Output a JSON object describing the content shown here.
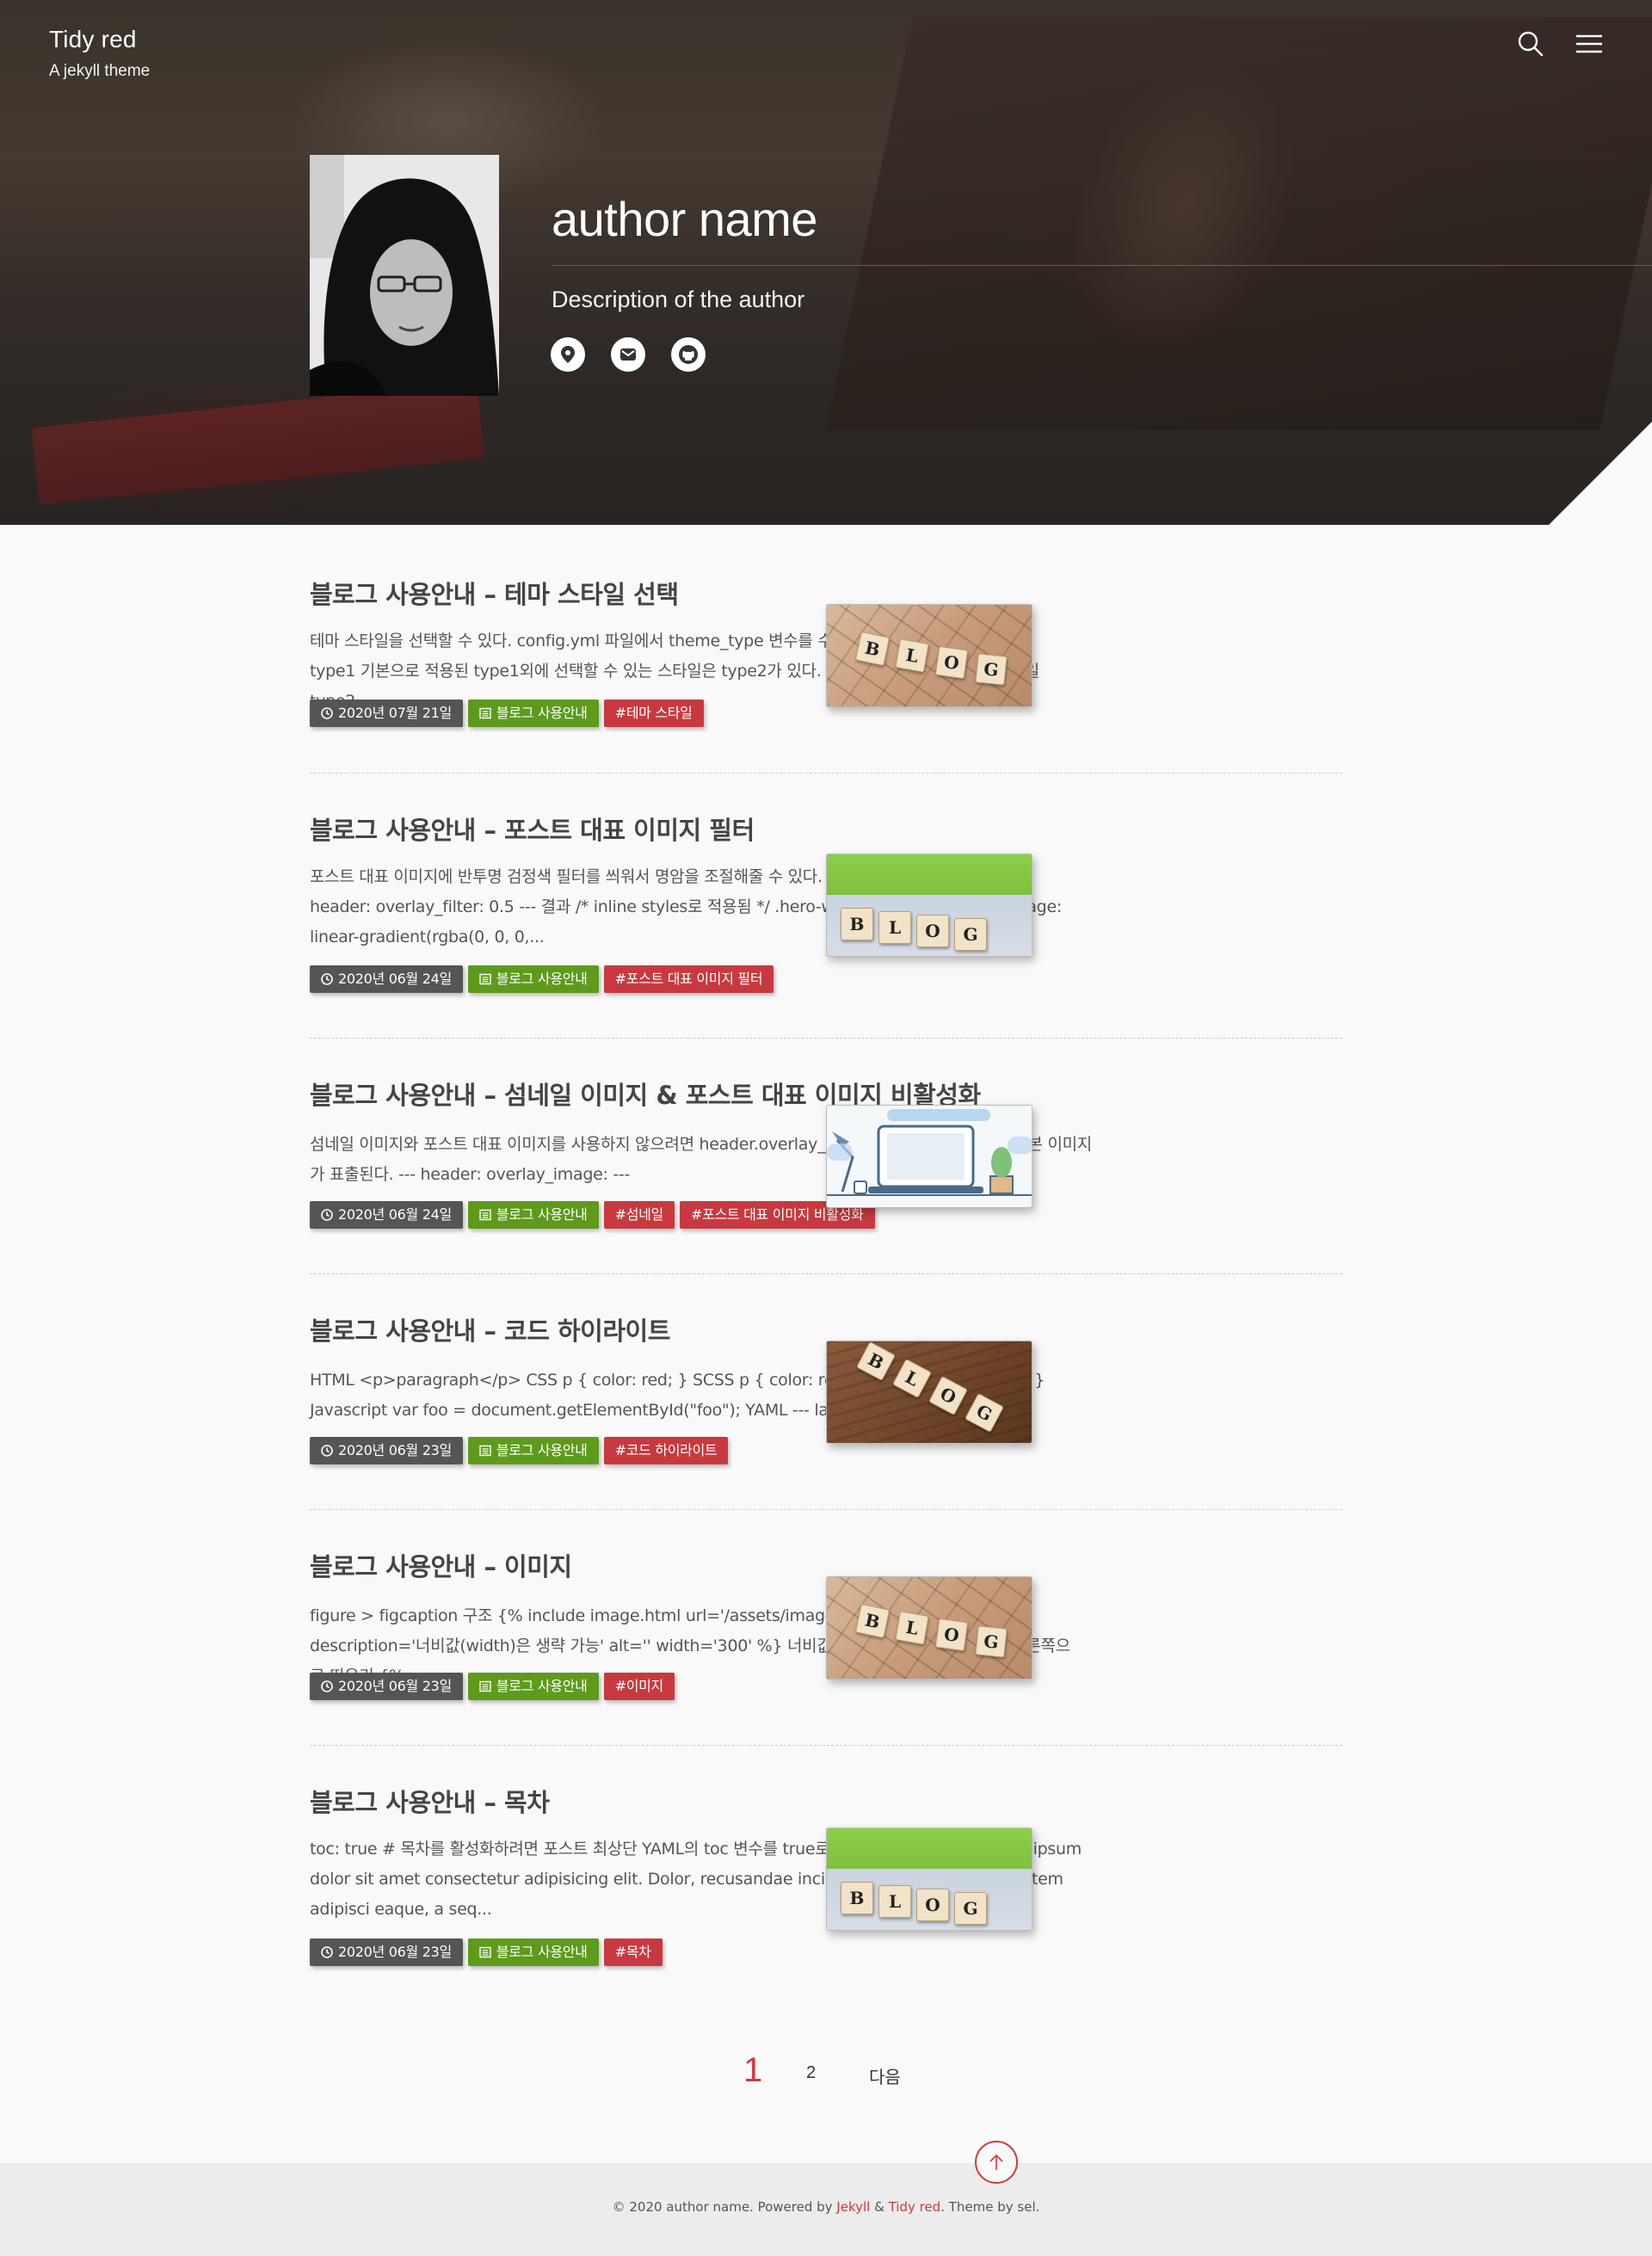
{
  "site": {
    "title": "Tidy red",
    "subtitle": "A jekyll theme"
  },
  "header": {
    "search_icon": "search-icon",
    "menu_icon": "hamburger-menu-icon"
  },
  "author": {
    "name": "author name",
    "description": "Description of the author",
    "social_icons": [
      "location-pin-icon",
      "envelope-icon",
      "github-icon"
    ]
  },
  "posts": [
    {
      "title": "블로그 사용안내 – 테마 스타일 선택",
      "excerpt": "테마 스타일을 선택할 수 있다. config.yml 파일에서 theme_type 변수를 수정해주면 됨. theme_type: type1 기본으로 적용된 type1외에 선택할 수 있는 스타일은 type2가 있다. 테마 스타일 type1 테마 스타일 type2",
      "date": "2020년 07월 21일",
      "category": "블로그 사용안내",
      "tags": [
        "#테마 스타일"
      ]
    },
    {
      "title": "블로그 사용안내 – 포스트 대표 이미지 필터",
      "excerpt": "포스트 대표 이미지에 반투명 검정색 필터를 씌워서 명암을 조절해줄 수 있다. 0.1 ~ 0.9 까지 사용 가능 --- header: overlay_filter: 0.5 --- 결과 /* inline styles로 적용됨 */ .hero-wrapper { background-image: linear-gradient(rgba(0, 0, 0,...",
      "date": "2020년 06월 24일",
      "category": "블로그 사용안내",
      "tags": [
        "#포스트 대표 이미지 필터"
      ]
    },
    {
      "title": "블로그 사용안내 – 섬네일 이미지 & 포스트 대표 이미지 비활성화",
      "excerpt": "섬네일 이미지와 포스트 대표 이미지를 사용하지 않으려면 header.overlay_image 변수값을 비워두기. 기본 이미지가 표출된다. --- header: overlay_image: ---",
      "date": "2020년 06월 24일",
      "category": "블로그 사용안내",
      "tags": [
        "#섬네일",
        "#포스트 대표 이미지 비활성화"
      ]
    },
    {
      "title": "블로그 사용안내 – 코드 하이라이트",
      "excerpt": "HTML <p>paragraph</p> CSS p { color: red; } SCSS p { color: red; &.blue { color: blue; } } Javascript var foo = document.getElementById(\"foo\"); YAML --- layo...",
      "date": "2020년 06월 23일",
      "category": "블로그 사용안내",
      "tags": [
        "#코드 하이라이트"
      ]
    },
    {
      "title": "블로그 사용안내 – 이미지",
      "excerpt": "figure > figcaption 구조 {% include image.html url='/assets/images/mhead_bg.jpg' description='너비값(width)은 생략 가능' alt='' width='300' %} 너비값(width)은 생략 가능 왼쪽/오른쪽으로 띄우기 {% ...",
      "date": "2020년 06월 23일",
      "category": "블로그 사용안내",
      "tags": [
        "#이미지"
      ]
    },
    {
      "title": "블로그 사용안내 – 목차",
      "excerpt": "toc: true # 목차를 활성화하려면 포스트 최상단 YAML의 toc 변수를 true로 설정해준다. 제목 h2 Lorem ipsum dolor sit amet consectetur adipisicing elit. Dolor, recusandae incidunt repellat fuga voluptatem adipisci eaque, a seq...",
      "date": "2020년 06월 23일",
      "category": "블로그 사용안내",
      "tags": [
        "#목차"
      ]
    }
  ],
  "thumb_letters": {
    "blog": [
      "B",
      "L",
      "O",
      "G"
    ]
  },
  "pagination": {
    "current": "1",
    "page2": "2",
    "next": "다음"
  },
  "footer": {
    "prefix": "© 2020 author name. Powered by ",
    "jekyll": "Jekyll",
    "amp": " & ",
    "theme": "Tidy red",
    "suffix": ". Theme by sel."
  },
  "colors": {
    "accent": "#d0393f",
    "category_tag": "#5e9a1c",
    "date_tag": "#555555"
  }
}
